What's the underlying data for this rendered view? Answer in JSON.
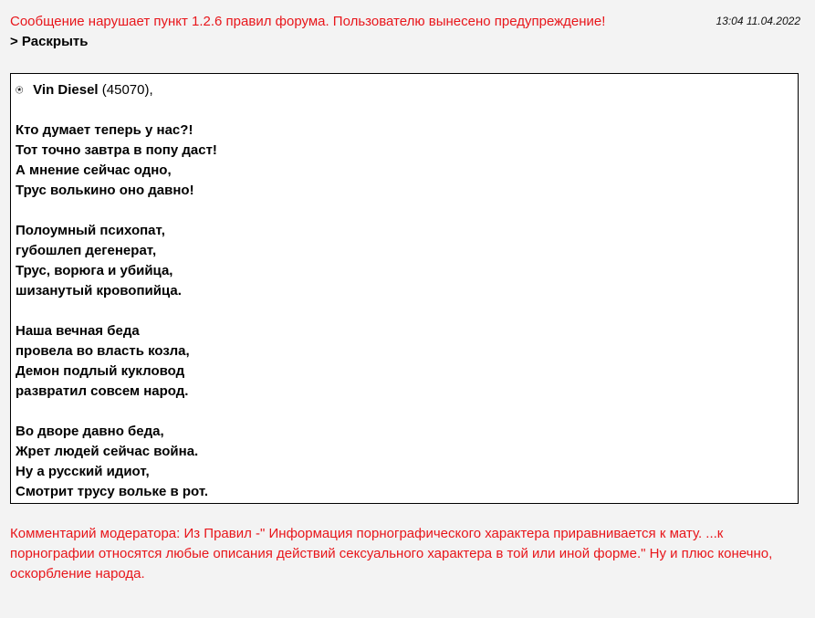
{
  "post": {
    "warning": "Сообщение нарушает пункт 1.2.6 правил форума. Пользователю вынесено предупреждение!",
    "timestamp": "13:04 11.04.2022",
    "expand_label": "> Раскрыть"
  },
  "quote": {
    "icon": "star-circle-icon",
    "icon_glyph": "⍟",
    "author": "Vin Diesel",
    "author_meta": " (45070),",
    "stanzas": [
      [
        "Кто думает теперь у нас?!",
        "Тот точно завтра в попу даст!",
        "А мнение сейчас одно,",
        "Трус волькино оно давно!"
      ],
      [
        "Полоумный психопат,",
        "губошлеп дегенерат,",
        "Трус, ворюга и убийца,",
        "шизанутый кровопийца."
      ],
      [
        "Наша вечная беда",
        "провела во власть козла,",
        "Демон подлый кукловод",
        "развратил совсем народ."
      ],
      [
        "Во дворе давно беда,",
        "Жрет людей сейчас война.",
        "Ну а русский идиот,",
        "Смотрит трусу вольке в рот."
      ]
    ]
  },
  "moderator_comment": "Комментарий модератора: Из Правил -\" Информация порнографического характера приравнивается к мату. ...к порнографии относятся любые описания действий сексуального характера в той или иной форме.\" Ну и плюс конечно, оскорбление народа.",
  "colors": {
    "warning": "#e8161b",
    "background": "#f3f3f3",
    "quote_background": "#ffffff"
  }
}
